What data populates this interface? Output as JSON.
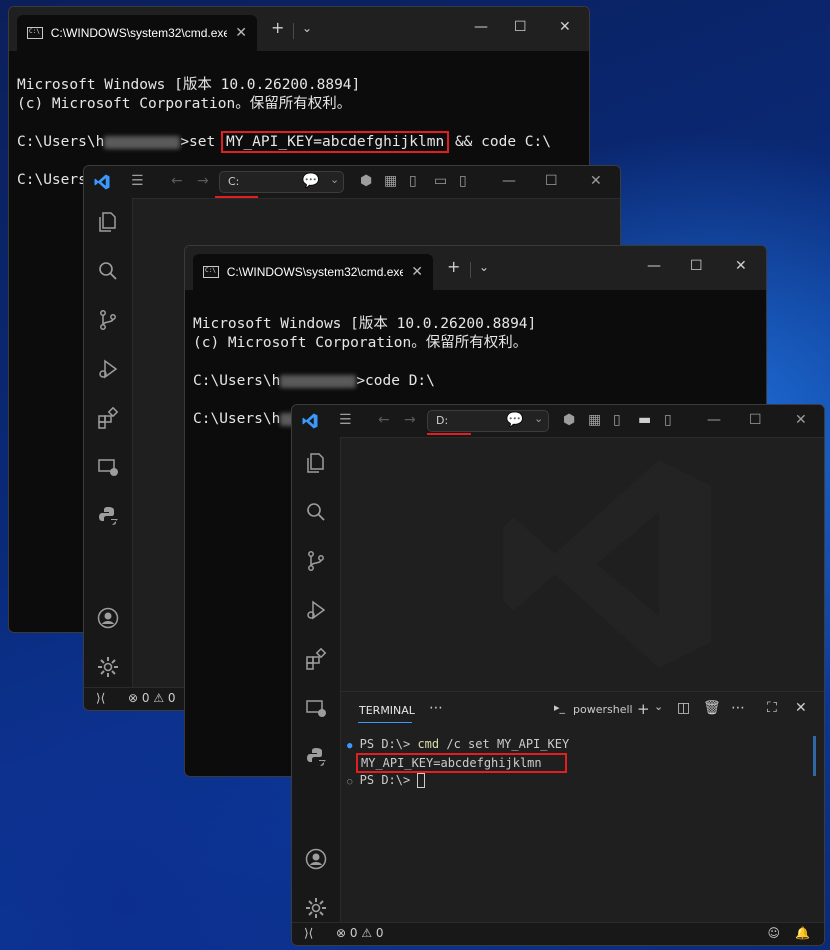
{
  "cmd_window_1": {
    "tab_title": "C:\\WINDOWS\\system32\\cmd.exe",
    "line1": "Microsoft Windows [版本 10.0.26200.8894]",
    "line2": "(c) Microsoft Corporation。保留所有权利。",
    "prompt_prefix": "C:\\Users\\h",
    "prompt_suffix": ">set ",
    "highlighted": "MY_API_KEY=abcdefghijklmn",
    "after_highlight": " && code C:\\",
    "prompt2_prefix": "C:\\Users\\h",
    "prompt2_suffix": ">"
  },
  "vscode_window_1": {
    "search_label": "C:",
    "errors": "0",
    "warnings": "0"
  },
  "cmd_window_2": {
    "tab_title": "C:\\WINDOWS\\system32\\cmd.exe",
    "line1": "Microsoft Windows [版本 10.0.26200.8894]",
    "line2": "(c) Microsoft Corporation。保留所有权利。",
    "prompt_prefix": "C:\\Users\\h",
    "prompt_suffix": ">code D:\\",
    "prompt2_prefix": "C:\\Users\\h",
    "prompt2_suffix": ">"
  },
  "vscode_window_2": {
    "search_label": "D:",
    "terminal_tab": "TERMINAL",
    "shell_label": "powershell",
    "lines": {
      "l1_prompt": "PS D:\\> ",
      "l1_cmd": "cmd",
      "l1_args": " /c set MY_API_KEY",
      "l2_output": "MY_API_KEY=abcdefghijklmn",
      "l3_prompt": "PS D:\\> "
    },
    "errors": "0",
    "warnings": "0"
  },
  "colors": {
    "highlight_box": "#e02020",
    "vscode_accent": "#3b99fc",
    "terminal_cmd": "#dcdcaa"
  }
}
